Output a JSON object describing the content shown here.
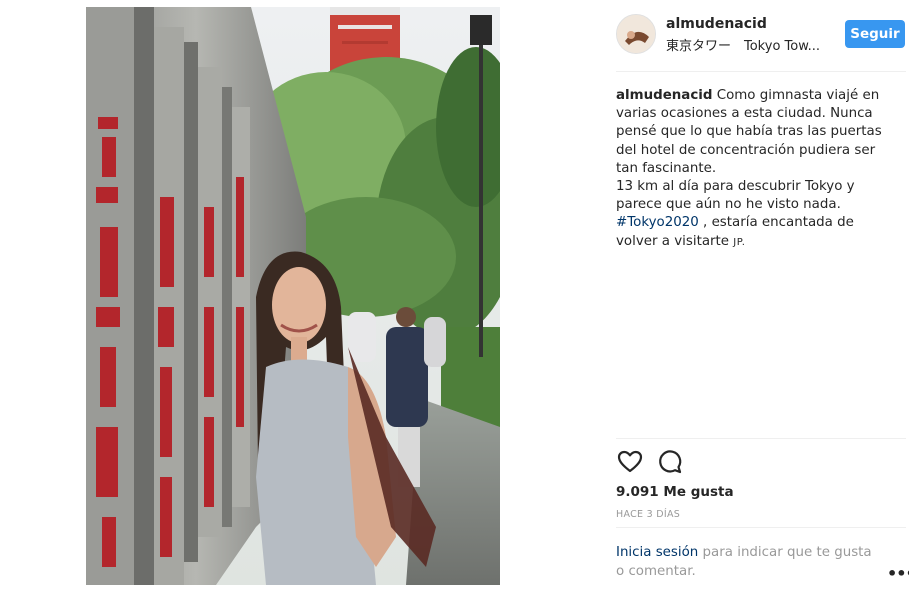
{
  "post": {
    "username": "almudenacid",
    "location": "東京タワー　Tokyo Tow...",
    "follow_label": "Seguir",
    "caption": {
      "username": "almudenacid",
      "line1": " Como gimnasta viajé en varias ocasiones a esta ciudad. Nunca pensé que lo que había tras las puertas del hotel de concentración pudiera ser tan fascinante.",
      "line2": "13 km al día para descubrir Tokyo y parece que aún no he visto nada.",
      "hashtag": "#Tokyo2020",
      "line3": " , estaría encantada de volver a visitarte ",
      "flag": "JP."
    },
    "likes": "9.091 Me gusta",
    "time_ago": "HACE 3 DÍAS",
    "login_prompt": {
      "link": "Inicia sesión",
      "text": " para indicar que te gusta o comentar."
    },
    "more_label": "•••"
  },
  "icons": {
    "like": "heart-icon",
    "comment": "comment-icon",
    "more": "more-options-icon"
  },
  "colors": {
    "follow_button": "#3897f0",
    "link": "#003569",
    "muted": "#999999"
  }
}
